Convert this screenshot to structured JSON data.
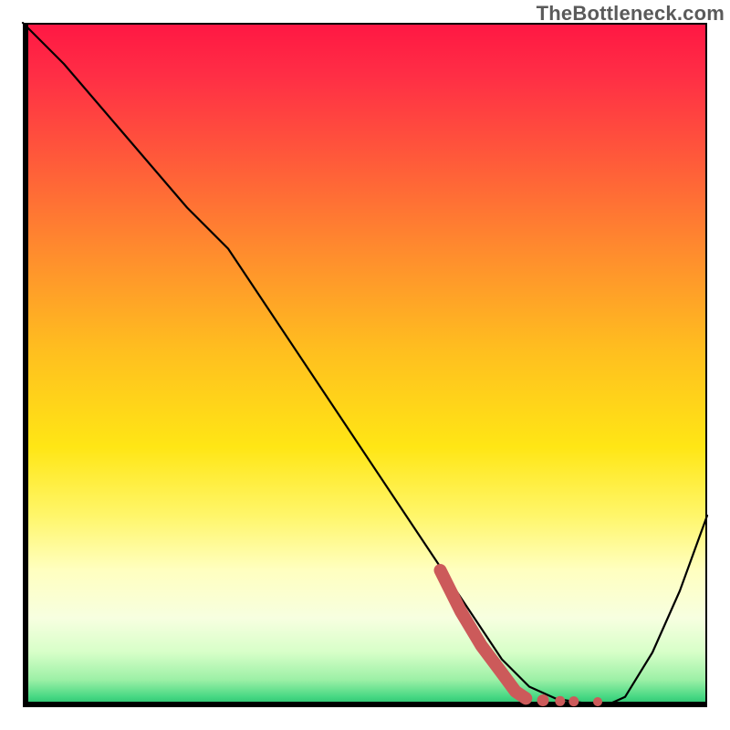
{
  "watermark": "TheBottleneck.com",
  "colors": {
    "curve": "#000000",
    "highlight": "#cc5a5a",
    "gradient_top": "#ff1744",
    "gradient_bottom": "#1fb96a"
  },
  "chart_data": {
    "type": "line",
    "title": "",
    "xlabel": "",
    "ylabel": "",
    "xlim": [
      0,
      100
    ],
    "ylim": [
      0,
      100
    ],
    "series": [
      {
        "name": "bottleneck-curve",
        "x": [
          0,
          6,
          12,
          18,
          24,
          30,
          36,
          42,
          48,
          54,
          60,
          66,
          70,
          74,
          78,
          82,
          86,
          88,
          92,
          96,
          100
        ],
        "y": [
          100,
          94,
          87,
          80,
          73,
          67,
          58,
          49,
          40,
          31,
          22,
          13,
          7,
          3,
          1.2,
          0.6,
          0.6,
          1.5,
          8,
          17,
          28
        ]
      }
    ],
    "highlight": {
      "name": "highlight-segment",
      "x": [
        61,
        64,
        67,
        70,
        72,
        73.5
      ],
      "y": [
        20,
        14,
        9,
        5,
        2.3,
        1.3
      ]
    },
    "highlight_dots": {
      "name": "highlight-dots",
      "x": [
        76,
        78.5,
        80.5,
        84
      ],
      "y": [
        1.0,
        0.9,
        0.85,
        0.8
      ],
      "r": [
        6.5,
        5.5,
        5.5,
        5.0
      ]
    }
  }
}
